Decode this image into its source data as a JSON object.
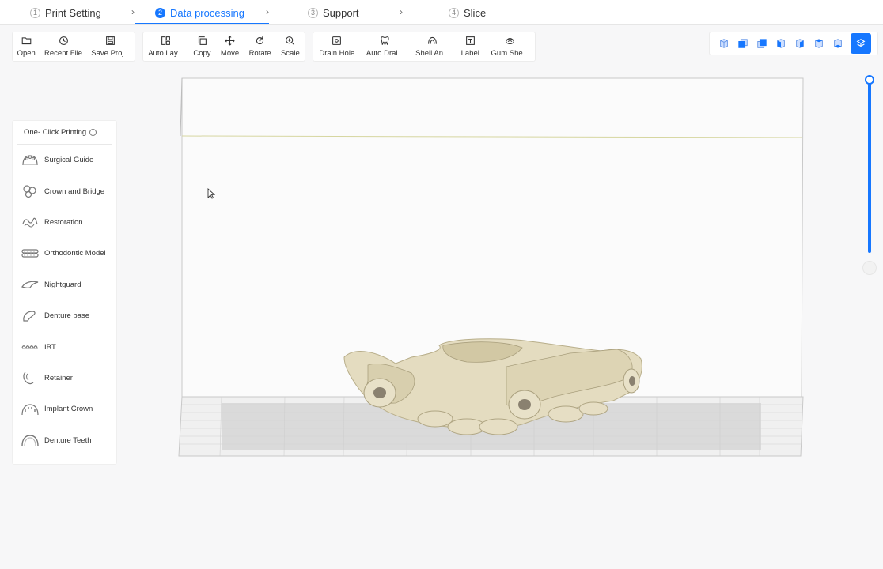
{
  "steps": [
    {
      "num": "1",
      "label": "Print Setting"
    },
    {
      "num": "2",
      "label": "Data processing"
    },
    {
      "num": "3",
      "label": "Support"
    },
    {
      "num": "4",
      "label": "Slice"
    }
  ],
  "step_chevron": "›",
  "toolbar": {
    "file": [
      {
        "label": "Open",
        "icon": "folder-icon"
      },
      {
        "label": "Recent File",
        "icon": "clock-icon"
      },
      {
        "label": "Save Proj...",
        "icon": "save-icon"
      }
    ],
    "edit": [
      {
        "label": "Auto Lay...",
        "icon": "layout-icon"
      },
      {
        "label": "Copy",
        "icon": "copy-icon"
      },
      {
        "label": "Move",
        "icon": "move-icon"
      },
      {
        "label": "Rotate",
        "icon": "rotate-icon"
      },
      {
        "label": "Scale",
        "icon": "zoom-icon"
      }
    ],
    "process": [
      {
        "label": "Drain Hole",
        "icon": "drain-hole-icon"
      },
      {
        "label": "Auto Drai...",
        "icon": "tooth-icon"
      },
      {
        "label": "Shell An...",
        "icon": "shell-icon"
      },
      {
        "label": "Label",
        "icon": "text-icon"
      },
      {
        "label": "Gum She...",
        "icon": "gum-icon"
      }
    ]
  },
  "side_panel": {
    "title": "One- Click Printing",
    "info_glyph": "i",
    "items": [
      {
        "label": "Surgical Guide"
      },
      {
        "label": "Crown and Bridge"
      },
      {
        "label": "Restoration"
      },
      {
        "label": "Orthodontic Model"
      },
      {
        "label": "Nightguard"
      },
      {
        "label": "Denture base"
      },
      {
        "label": "IBT"
      },
      {
        "label": "Retainer"
      },
      {
        "label": "Implant Crown"
      },
      {
        "label": "Denture Teeth"
      }
    ]
  },
  "colors": {
    "accent": "#1677ff",
    "model": "#e4dcc0",
    "platform": "#d8d8d8"
  }
}
